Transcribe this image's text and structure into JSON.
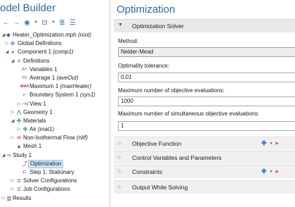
{
  "left": {
    "title": "odel Builder",
    "tree": [
      {
        "label": "Heater_Optimization.mph",
        "tag": "(root)",
        "icon": "file-icon"
      },
      {
        "label": "Global Definitions",
        "tag": "",
        "icon": "globe-icon"
      },
      {
        "label": "Component 1",
        "tag": "(comp1)",
        "icon": "component-icon"
      },
      {
        "label": "Definitions",
        "tag": "",
        "icon": "definitions-icon"
      },
      {
        "label": "Variables 1",
        "tag": "",
        "icon": "variables-icon"
      },
      {
        "label": "Average 1",
        "tag": "(aveOut)",
        "icon": "average-icon"
      },
      {
        "label": "Maximum 1",
        "tag": "(maxHeater)",
        "icon": "max-icon"
      },
      {
        "label": "Boundary System 1",
        "tag": "(sys1)",
        "icon": "coord-icon"
      },
      {
        "label": "View 1",
        "tag": "",
        "icon": "view-icon"
      },
      {
        "label": "Geometry 1",
        "tag": "",
        "icon": "geometry-icon"
      },
      {
        "label": "Materials",
        "tag": "",
        "icon": "materials-icon"
      },
      {
        "label": "Air",
        "tag": "(mat1)",
        "icon": "material-icon"
      },
      {
        "label": "Non-Isothermal Flow",
        "tag": "(nitf)",
        "icon": "physics-icon"
      },
      {
        "label": "Mesh 1",
        "tag": "",
        "icon": "mesh-icon"
      },
      {
        "label": "Study 1",
        "tag": "",
        "icon": "study-icon"
      },
      {
        "label": "Optimization",
        "tag": "",
        "icon": "optimization-icon"
      },
      {
        "label": "Step 1: Stationary",
        "tag": "",
        "icon": "step-icon"
      },
      {
        "label": "Solver Configurations",
        "tag": "",
        "icon": "solver-icon"
      },
      {
        "label": "Job Configurations",
        "tag": "",
        "icon": "job-icon"
      },
      {
        "label": "Results",
        "tag": "",
        "icon": "results-icon"
      }
    ]
  },
  "right": {
    "title": "Optimization",
    "solver_header": "Optimization Solver",
    "method_label": "Method:",
    "method_value": "Nelder-Mead",
    "tolerance_label": "Optimality tolerance:",
    "tolerance_value": "0.01",
    "max_eval_label": "Maximum number of objective evaluations:",
    "max_eval_value": "1000",
    "max_sim_label": "Maximum number of simultaneous objective evaluations:",
    "max_sim_value": "1",
    "sections": [
      {
        "label": "Objective Function"
      },
      {
        "label": "Control Variables and Parameters"
      },
      {
        "label": "Constraints"
      },
      {
        "label": "Output While Solving"
      }
    ]
  },
  "colors": {
    "title_blue": "#2a6aa8",
    "selection": "#cce6f7",
    "section_bg": "#f0f0f0",
    "accent_plus": "#2f73c6",
    "accent_flag": "#d64b8a"
  }
}
